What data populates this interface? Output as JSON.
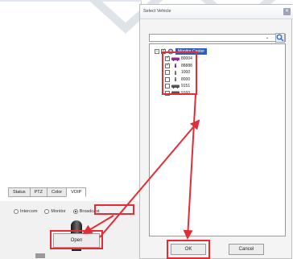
{
  "left_panel": {
    "tabs": [
      {
        "label": "Status"
      },
      {
        "label": "PTZ"
      },
      {
        "label": "Color"
      },
      {
        "label": "VOIP"
      }
    ],
    "modes": [
      {
        "label": "Intercom",
        "checked": false
      },
      {
        "label": "Monitor",
        "checked": false
      },
      {
        "label": "Broadcast",
        "checked": true
      }
    ],
    "open_label": "Open"
  },
  "dialog": {
    "title": "Select Vehicle",
    "close_glyph": "✕",
    "search": {
      "value": "",
      "dropdown_glyph": "⌄"
    },
    "tree": {
      "root": {
        "expander": "−",
        "label": "Monitor Center",
        "checked": true
      },
      "items": [
        {
          "label": "80004",
          "checked": true,
          "icon": "vehicle-icon",
          "icon_color": "#9b2a8b"
        },
        {
          "label": "88888",
          "checked": true,
          "icon": "person-icon",
          "icon_color": "#7a1fa8"
        },
        {
          "label": "1000",
          "checked": false,
          "icon": "person-icon",
          "icon_color": "#666666"
        },
        {
          "label": "8000",
          "checked": false,
          "icon": "person-icon",
          "icon_color": "#666666"
        },
        {
          "label": "9151",
          "checked": false,
          "icon": "vehicle-icon",
          "icon_color": "#555555"
        },
        {
          "label": "9160",
          "checked": false,
          "icon": "vehicle-icon",
          "icon_color": "#555555"
        }
      ]
    },
    "ok_label": "OK",
    "cancel_label": "Cancel"
  },
  "colors": {
    "highlight": "#e22d36",
    "selection": "#2f5fb4"
  }
}
